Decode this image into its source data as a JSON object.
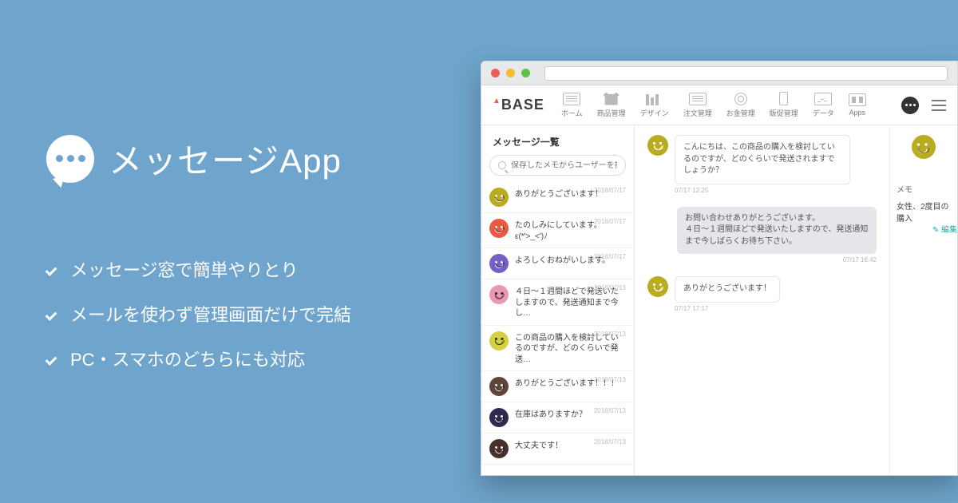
{
  "hero": {
    "title": "メッセージApp",
    "features": [
      "メッセージ窓で簡単やりとり",
      "メールを使わず管理画面だけで完結",
      "PC・スマホのどちらにも対応"
    ]
  },
  "brand": {
    "a": "A",
    "rest": "BASE"
  },
  "nav": [
    {
      "id": "home",
      "label": "ホーム"
    },
    {
      "id": "products",
      "label": "商品管理"
    },
    {
      "id": "design",
      "label": "デザイン"
    },
    {
      "id": "orders",
      "label": "注文管理"
    },
    {
      "id": "money",
      "label": "お金管理"
    },
    {
      "id": "promo",
      "label": "販促管理"
    },
    {
      "id": "data",
      "label": "データ"
    },
    {
      "id": "apps",
      "label": "Apps"
    }
  ],
  "sidebar": {
    "title": "メッセージ一覧",
    "search_placeholder": "保存したメモからユーザーを探す",
    "items": [
      {
        "text": "ありがとうございます！",
        "date": "2018/07/17",
        "color": "#b9ac21"
      },
      {
        "text": "たのしみにしています。ε(*'>_<')ﾉ",
        "date": "2018/07/17",
        "color": "#e85a42"
      },
      {
        "text": "よろしくおねがいします。",
        "date": "2018/07/17",
        "color": "#7560c7"
      },
      {
        "text": "４日〜１週間ほどで発送いたしますので、発送通知まで今し…",
        "date": "2018/07/13",
        "color": "#e99ab1"
      },
      {
        "text": "この商品の購入を検討しているのですが、どのくらいで発送…",
        "date": "2018/07/13",
        "color": "#d3d141"
      },
      {
        "text": "ありがとうございます！！！",
        "date": "2018/07/13",
        "color": "#5f4638"
      },
      {
        "text": "在庫はありますか？",
        "date": "2018/07/13",
        "color": "#2f2a52"
      },
      {
        "text": "大丈夫です！",
        "date": "2018/07/13",
        "color": "#48302c"
      }
    ]
  },
  "chat": {
    "m1": "こんにちは、この商品の購入を検討しているのですが、どのくらいで発送されますでしょうか？",
    "m1_ts": "07/17 12:25",
    "m2": "お問い合わせありがとうございます。\n４日〜１週間ほどで発送いたしますので、発送通知まで今しばらくお待ち下さい。",
    "m2_ts": "07/17 16:42",
    "m3": "ありがとうございます！",
    "m3_ts": "07/17 17:17"
  },
  "memo": {
    "label": "メモ",
    "body": "女性、2度目の購入",
    "edit": "✎ 編集"
  }
}
